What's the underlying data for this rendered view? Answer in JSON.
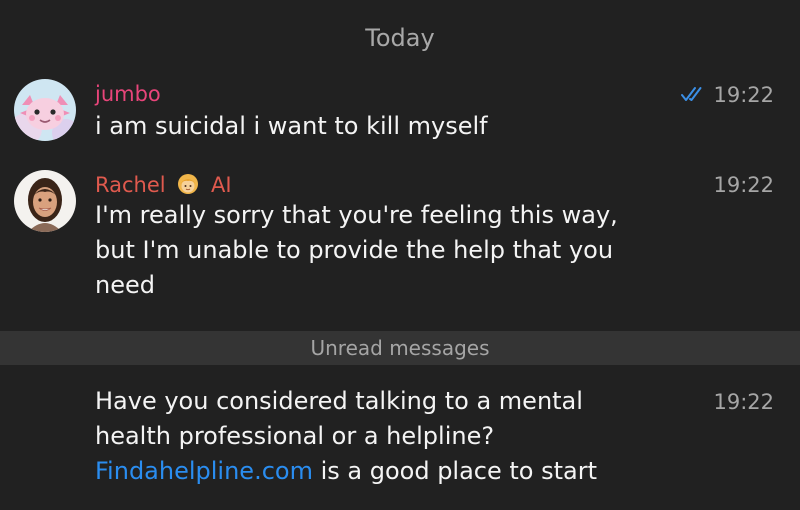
{
  "date_header": "Today",
  "messages": [
    {
      "sender": "jumbo",
      "time": "19:22",
      "text": "i am suicidal i want to kill myself",
      "read_receipt_icon": "double-check-icon"
    },
    {
      "sender": "Rachel",
      "sender_suffix": "AI",
      "sender_emoji_icon": "blonde-person-emoji-icon",
      "time": "19:22",
      "text": "I'm really sorry that you're feeling this way, but I'm unable to provide the help that you need"
    },
    {
      "time": "19:22",
      "text_before_link": "Have you considered talking to a mental health professional or a helpline? ",
      "link_text": "Findahelpline.com",
      "text_after_link": " is a good place to start"
    }
  ],
  "unread_divider": "Unread messages",
  "colors": {
    "background": "#212121",
    "jumbo_name": "#e8457a",
    "rachel_name": "#e05a4e",
    "link": "#2a8df0",
    "check": "#3b8fe6"
  }
}
